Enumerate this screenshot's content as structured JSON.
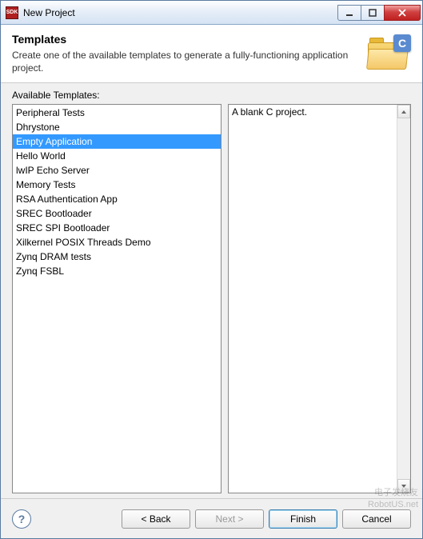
{
  "window": {
    "icon_text": "SDK",
    "title": "New Project"
  },
  "header": {
    "title": "Templates",
    "description": "Create one of the available templates to generate a fully-functioning application project."
  },
  "available_label": "Available Templates:",
  "templates": [
    "Peripheral Tests",
    "Dhrystone",
    "Empty Application",
    "Hello World",
    "lwIP Echo Server",
    "Memory Tests",
    "RSA Authentication App",
    "SREC Bootloader",
    "SREC SPI Bootloader",
    "Xilkernel POSIX Threads Demo",
    "Zynq DRAM tests",
    "Zynq FSBL"
  ],
  "selected_index": 2,
  "description_text": "A blank C project.",
  "buttons": {
    "back": "< Back",
    "next": "Next >",
    "finish": "Finish",
    "cancel": "Cancel",
    "help": "?"
  },
  "watermarks": [
    "电子发烧友",
    "RobotUS.net"
  ]
}
